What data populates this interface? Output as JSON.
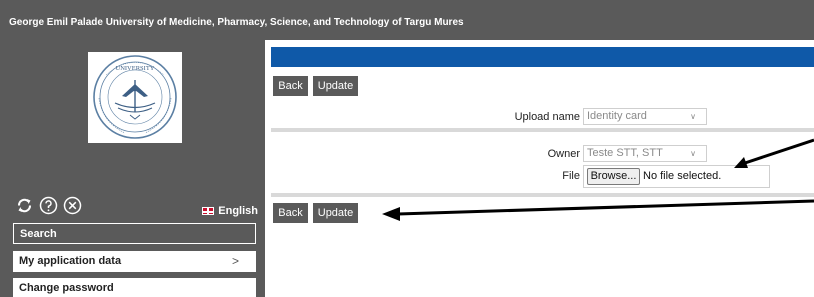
{
  "header": {
    "title": "George Emil Palade University of Medicine, Pharmacy, Science, and Technology of Targu Mures"
  },
  "sidebar": {
    "logo_text": "UNIVERSITY",
    "language": "English",
    "search_placeholder": "Search",
    "links": [
      {
        "label": "My application data",
        "chevron": ">"
      },
      {
        "label": "Change password"
      }
    ]
  },
  "form": {
    "back_label": "Back",
    "update_label": "Update",
    "upload_name_label": "Upload name",
    "upload_name_value": "Identity card",
    "owner_label": "Owner",
    "owner_value": "Teste STT, STT",
    "file_label": "File",
    "browse_label": "Browse...",
    "file_status": "No file selected."
  },
  "colors": {
    "chrome": "#5a5a5a",
    "accent_bar": "#0f59a8",
    "separator": "#d9d9d9"
  },
  "icons": [
    "refresh-icon",
    "help-icon",
    "close-icon",
    "uk-flag-icon",
    "chevron-right-icon"
  ]
}
